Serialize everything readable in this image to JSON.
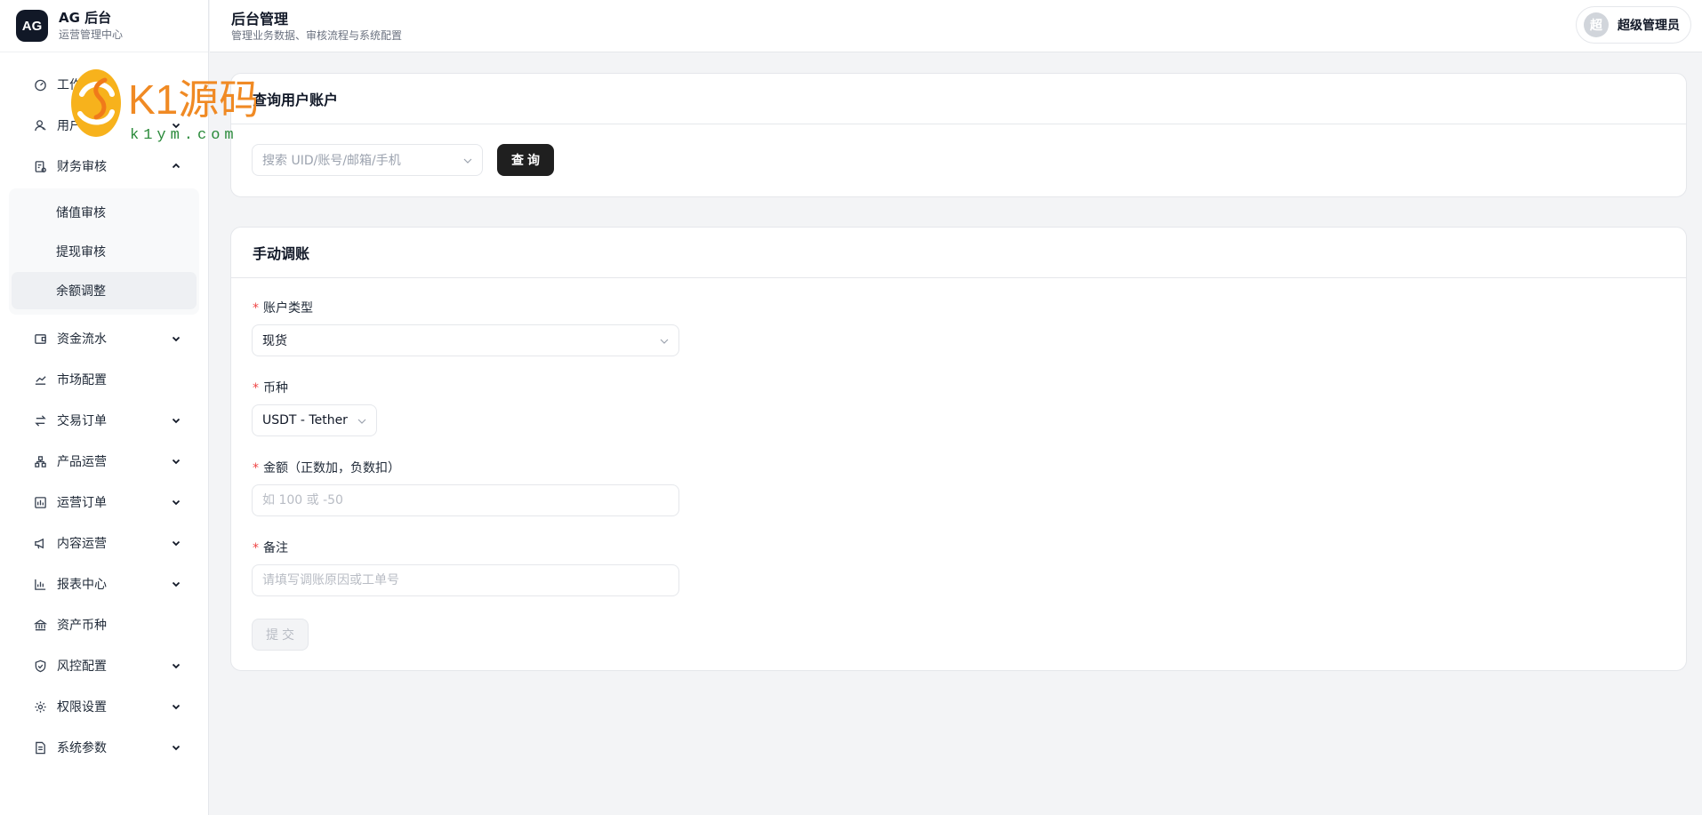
{
  "brand": {
    "logo": "AG",
    "title": "AG 后台",
    "subtitle": "运营管理中心"
  },
  "header": {
    "title": "后台管理",
    "subtitle": "管理业务数据、审核流程与系统配置"
  },
  "user": {
    "avatar": "超",
    "name": "超级管理员"
  },
  "watermark": {
    "brand": "K1源码",
    "url": "k1ym.com"
  },
  "sidebar": {
    "items": [
      {
        "label": "工作台",
        "icon": "dashboard-icon",
        "chevron": false
      },
      {
        "label": "用户",
        "icon": "user-icon",
        "chevron": true
      },
      {
        "label": "财务审核",
        "icon": "audit-icon",
        "chevron": true,
        "expanded": true,
        "children": [
          {
            "label": "储值审核",
            "active": false
          },
          {
            "label": "提现审核",
            "active": false
          },
          {
            "label": "余额调整",
            "active": true
          }
        ]
      },
      {
        "label": "资金流水",
        "icon": "wallet-icon",
        "chevron": true
      },
      {
        "label": "市场配置",
        "icon": "trend-icon",
        "chevron": false
      },
      {
        "label": "交易订单",
        "icon": "swap-icon",
        "chevron": true
      },
      {
        "label": "产品运营",
        "icon": "hierarchy-icon",
        "chevron": true
      },
      {
        "label": "运营订单",
        "icon": "bar-box-icon",
        "chevron": true
      },
      {
        "label": "内容运营",
        "icon": "megaphone-icon",
        "chevron": true
      },
      {
        "label": "报表中心",
        "icon": "bar-chart-icon",
        "chevron": true
      },
      {
        "label": "资产币种",
        "icon": "bank-icon",
        "chevron": false
      },
      {
        "label": "风控配置",
        "icon": "shield-icon",
        "chevron": true
      },
      {
        "label": "权限设置",
        "icon": "gear-icon",
        "chevron": true
      },
      {
        "label": "系统参数",
        "icon": "document-icon",
        "chevron": true
      }
    ]
  },
  "query_card": {
    "title": "查询用户账户",
    "search_placeholder": "搜索 UID/账号/邮箱/手机",
    "search_button": "查询"
  },
  "adjust_card": {
    "title": "手动调账",
    "account_type": {
      "label": "账户类型",
      "value": "现货"
    },
    "currency": {
      "label": "币种",
      "value": "USDT - Tether"
    },
    "amount": {
      "label": "金额（正数加，负数扣）",
      "placeholder": "如 100 或 -50"
    },
    "note": {
      "label": "备注",
      "placeholder": "请填写调账原因或工单号"
    },
    "submit": "提交"
  }
}
